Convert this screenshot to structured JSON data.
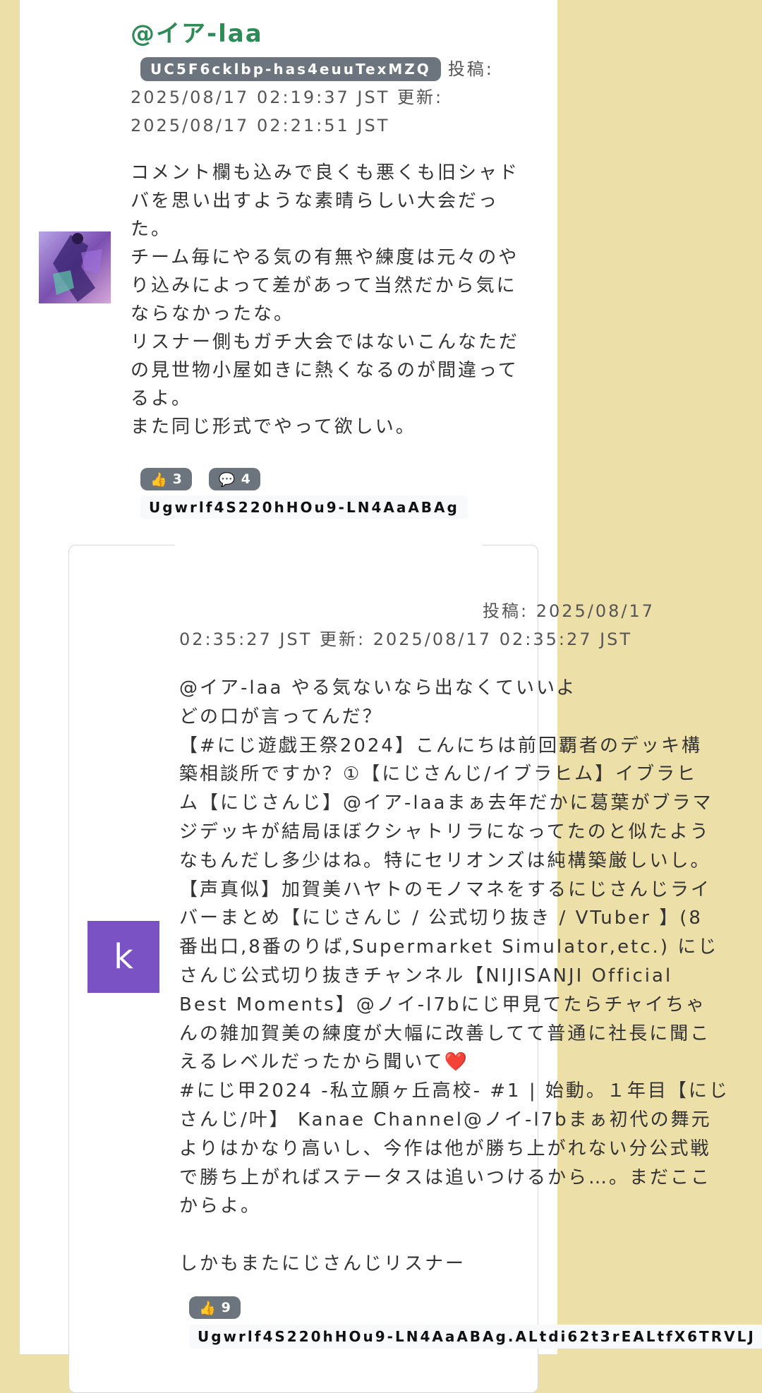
{
  "comment": {
    "username": "@イア-laa",
    "channel_id": "UC5F6cklbp-has4euuTexMZQ",
    "meta_line1": "投稿:",
    "meta_line2": "2025/08/17 02:19:37 JST 更新:",
    "meta_line3": "2025/08/17 02:21:51 JST",
    "text": "コメント欄も込みで良くも悪くも旧シャド\nバを思い出すような素晴らしい大会だっ\nた。\nチーム毎にやる気の有無や練度は元々のや\nり込みによって差があって当然だから気に\nならなかったな。\nリスナー側もガチ大会ではないこんなただ\nの見世物小屋如きに熱くなるのが間違って\nるよ。\nまた同じ形式でやって欲しい。",
    "likes": "3",
    "replies": "4",
    "comment_id": "Ugwrlf4S220hHOu9-LN4AaABAg",
    "avatar_icon": "anime-avatar-icon"
  },
  "reply": {
    "avatar_letter": "k",
    "meta_line1": "投稿: 2025/08/17",
    "meta_line2": "02:35:27 JST 更新: 2025/08/17 02:35:27 JST",
    "text": "@イア-laa やる気ないなら出なくていいよ\nどの口が言ってんだ？\n【#にじ遊戯王祭2024】こんにちは前回覇者のデッキ構\n築相談所ですか？①【にじさんじ/イブラヒム】イブラヒ\nム【にじさんじ】@イア-laaまぁ去年だかに葛葉がブラマ\nジデッキが結局ほぼクシャトリラになってたのと似たよう\nなもんだし多少はね。特にセリオンズは純構築厳しいし。\n【声真似】加賀美ハヤトのモノマネをするにじさんじライ\nバーまとめ【にじさんじ / 公式切り抜き / VTuber 】(8\n番出口,8番のりば,Supermarket Simulator,etc.) にじ\nさんじ公式切り抜きチャンネル【NIJISANJI Official\nBest Moments】@ノイ-l7bにじ甲見てたらチャイちゃ\nんの雑加賀美の練度が大幅に改善してて普通に社長に聞こ\nえるレベルだったから聞いて❤️\n#にじ甲2024 -私立願ヶ丘高校- #1 | 始動。１年目【にじ\nさんじ/叶】 Kanae Channel@ノイ-l7bまぁ初代の舞元\nよりはかなり高いし、今作は他が勝ち上がれない分公式戦\nで勝ち上がればステータスは追いつけるから…。まだここ\nからよ。\n\nしかもまたにじさんじリスナー",
    "likes": "9",
    "comment_id": "Ugwrlf4S220hHOu9-LN4AaABAg.ALtdi62t3rEALtfX6TRVLJ"
  }
}
